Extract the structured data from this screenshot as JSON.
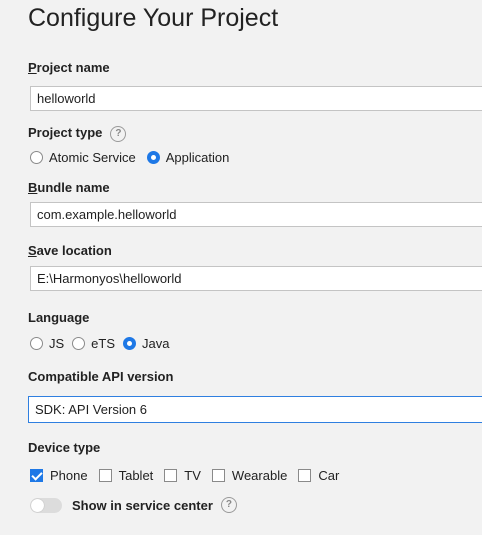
{
  "page_title": "Configure Your Project",
  "project_name": {
    "label_mnemonic": "P",
    "label_rest": "roject name",
    "value": "helloworld"
  },
  "project_type": {
    "label": "Project type",
    "help": "?",
    "options": [
      {
        "label": "Atomic Service",
        "selected": false
      },
      {
        "label": "Application",
        "selected": true
      }
    ]
  },
  "bundle_name": {
    "label_mnemonic": "B",
    "label_rest": "undle name",
    "value": "com.example.helloworld"
  },
  "save_location": {
    "label_mnemonic": "S",
    "label_rest": "ave location",
    "value": "E:\\Harmonyos\\helloworld"
  },
  "language": {
    "label": "Language",
    "options": [
      {
        "label": "JS",
        "selected": false
      },
      {
        "label": "eTS",
        "selected": false
      },
      {
        "label": "Java",
        "selected": true
      }
    ]
  },
  "compatible_api": {
    "label": "Compatible API version",
    "value": "SDK: API Version 6"
  },
  "device_type": {
    "label": "Device type",
    "options": [
      {
        "label": "Phone",
        "checked": true
      },
      {
        "label": "Tablet",
        "checked": false
      },
      {
        "label": "TV",
        "checked": false
      },
      {
        "label": "Wearable",
        "checked": false
      },
      {
        "label": "Car",
        "checked": false
      }
    ]
  },
  "service_center": {
    "label": "Show in service center",
    "enabled": false,
    "help": "?"
  },
  "colors": {
    "accent": "#1e78e6",
    "background": "#f2f2f2"
  }
}
